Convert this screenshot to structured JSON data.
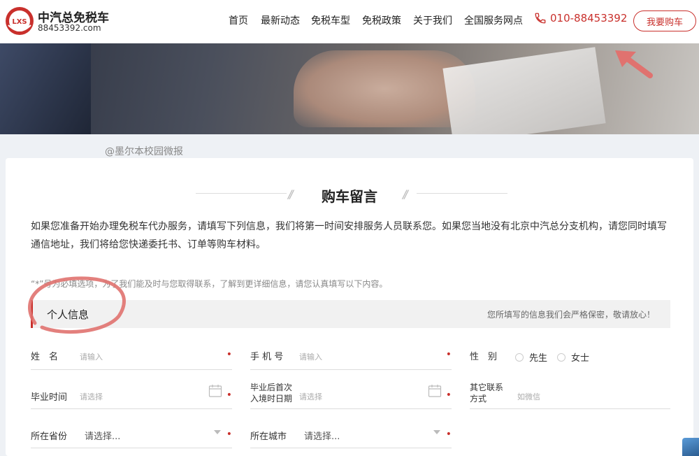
{
  "header": {
    "brand_name": "中汽总免税车",
    "brand_url": "88453392.com",
    "logo_text": "LXS",
    "nav": [
      "首页",
      "最新动态",
      "免税车型",
      "免税政策",
      "关于我们",
      "全国服务网点"
    ],
    "phone": "010-88453392",
    "buy_button": "我要购车"
  },
  "watermark": "@墨尔本校园微报",
  "page": {
    "title": "购车留言",
    "intro": "如果您准备开始办理免税车代办服务，请填写下列信息，我们将第一时间安排服务人员联系您。如果您当地没有北京中汽总分支机构，请您同时填写通信地址，我们将给您快递委托书、订单等购车材料。",
    "note": "“*”号为必填选项，为了我们能及时与您取得联系，了解到更详细信息，请您认真填写以下内容。"
  },
  "section": {
    "title": "个人信息",
    "tip": "您所填写的信息我们会严格保密，敬请放心！"
  },
  "form": {
    "name_label": "姓　名",
    "name_placeholder": "请输入",
    "phone_label": "手 机 号",
    "phone_placeholder": "请输入",
    "gender_label": "性　别",
    "gender_options": [
      "先生",
      "女士"
    ],
    "grad_label": "毕业时间",
    "grad_placeholder": "请选择",
    "entry_label_1": "毕业后首次",
    "entry_label_2": "入境时日期",
    "entry_placeholder": "请选择",
    "contact_label_1": "其它联系",
    "contact_label_2": "方式",
    "contact_placeholder": "如微信",
    "province_label": "所在省份",
    "province_value": "请选择...",
    "city_label": "所在城市",
    "city_value": "请选择...",
    "required_mark": "•"
  },
  "colors": {
    "accent": "#c9302c"
  }
}
